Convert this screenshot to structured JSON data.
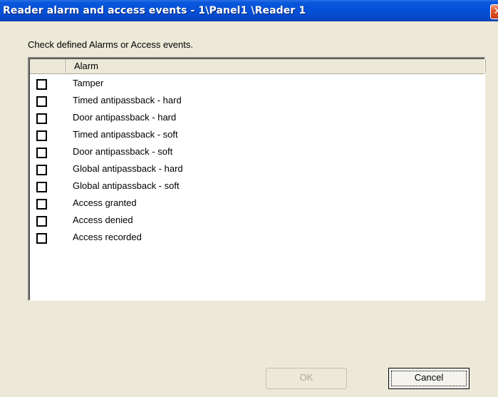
{
  "window": {
    "title": "Reader alarm and access events - 1\\Panel1 \\Reader 1",
    "close_glyph": "✕"
  },
  "instruction": "Check defined Alarms or Access events.",
  "list": {
    "columns": [
      "",
      "Alarm"
    ],
    "items": [
      {
        "label": "Tamper",
        "checked": false
      },
      {
        "label": "Timed antipassback - hard",
        "checked": false
      },
      {
        "label": "Door antipassback - hard",
        "checked": false
      },
      {
        "label": "Timed antipassback - soft",
        "checked": false
      },
      {
        "label": "Door antipassback - soft",
        "checked": false
      },
      {
        "label": "Global antipassback - hard",
        "checked": false
      },
      {
        "label": "Global antipassback - soft",
        "checked": false
      },
      {
        "label": "Access granted",
        "checked": false
      },
      {
        "label": "Access denied",
        "checked": false
      },
      {
        "label": "Access recorded",
        "checked": false
      }
    ]
  },
  "buttons": {
    "ok": "OK",
    "cancel": "Cancel"
  },
  "colors": {
    "titlebar": "#0550d8",
    "dialog_bg": "#ece9d8",
    "close_button": "#e2572b"
  }
}
